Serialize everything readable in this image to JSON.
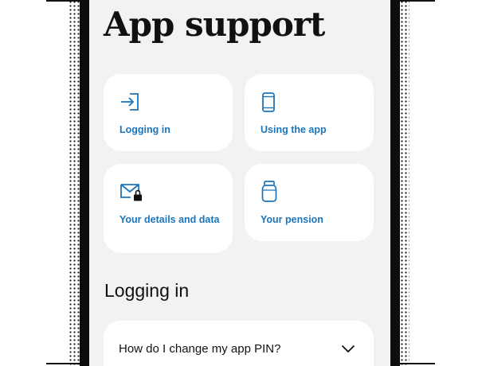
{
  "page": {
    "title": "App support"
  },
  "categories": [
    {
      "label": "Logging in",
      "icon": "login-arrow-icon"
    },
    {
      "label": "Using the app",
      "icon": "mobile-phone-icon"
    },
    {
      "label": "Your details and data",
      "icon": "envelope-lock-icon"
    },
    {
      "label": "Your pension",
      "icon": "jar-icon"
    }
  ],
  "sections": [
    {
      "heading": "Logging in",
      "faqs": [
        {
          "question": "How do I change my app PIN?",
          "icon": "chevron-down-icon"
        }
      ]
    }
  ],
  "colors": {
    "accent": "#1b75bb",
    "screen_background": "#f2f2f2",
    "card_background": "#ffffff",
    "text": "#111111",
    "frame": "#0d0d0d"
  }
}
